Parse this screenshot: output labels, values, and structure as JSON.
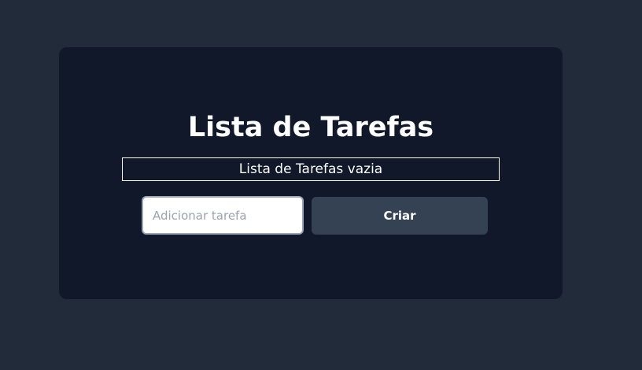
{
  "app": {
    "title": "Lista de Tarefas",
    "empty_message": "Lista de Tarefas vazia"
  },
  "form": {
    "input_placeholder": "Adicionar tarefa",
    "input_value": "",
    "create_label": "Criar"
  },
  "colors": {
    "page_background": "#222b3a",
    "card_background": "#10182a",
    "button_background": "#344254",
    "text_primary": "#ffffff"
  }
}
